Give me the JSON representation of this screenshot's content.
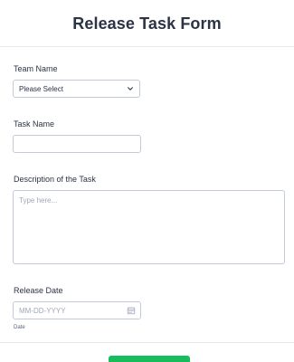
{
  "form": {
    "title": "Release Task Form"
  },
  "fields": {
    "team_name": {
      "label": "Team Name",
      "selected": "Please Select"
    },
    "task_name": {
      "label": "Task Name",
      "value": ""
    },
    "description": {
      "label": "Description of the Task",
      "placeholder": "Type here..."
    },
    "release_date": {
      "label": "Release Date",
      "placeholder": "MM-DD-YYYY",
      "sublabel": "Date"
    }
  },
  "submit": {
    "label": ""
  },
  "icons": {
    "select_chevron": "chevron-down-icon",
    "date_picker": "calendar-icon"
  },
  "colors": {
    "title": "#2c3345",
    "border": "#c3cad8",
    "placeholder": "#a0a7b8",
    "submit": "#18bd5b"
  }
}
